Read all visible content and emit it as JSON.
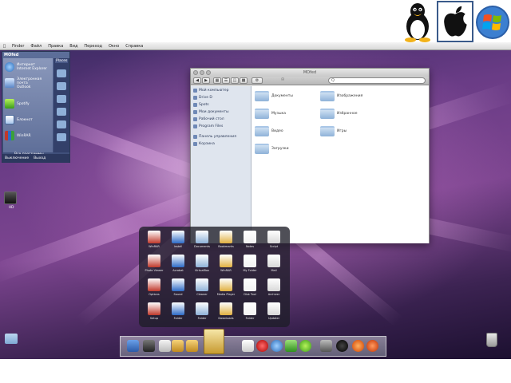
{
  "os_choices": [
    {
      "name": "linux-logo",
      "selected": false
    },
    {
      "name": "apple-logo",
      "selected": true
    },
    {
      "name": "windows-logo",
      "selected": false
    }
  ],
  "menubar": {
    "items": [
      "Finder",
      "Файл",
      "Правка",
      "Вид",
      "Переход",
      "Окно",
      "Справка"
    ]
  },
  "start_menu": {
    "user": "MOfed",
    "places_label": "Places",
    "items": [
      {
        "label": "Интернет",
        "sub": "Internet Explorer",
        "icon": "ie-icon"
      },
      {
        "label": "Электронная почта",
        "sub": "Outlook",
        "icon": "mail-icon"
      },
      {
        "label": "Spotify",
        "sub": "",
        "icon": "green-app-icon"
      },
      {
        "label": "Блокнот",
        "sub": "",
        "icon": "notepad-icon"
      },
      {
        "label": "WinRAR",
        "sub": "",
        "icon": "winrar-icon"
      }
    ],
    "all_programs": "Все программы",
    "bottom": [
      "Выключение",
      "Выход"
    ]
  },
  "desktop": {
    "hd_label": "HD"
  },
  "finder": {
    "title": "MOfed",
    "search_placeholder": "Q",
    "sidebar": [
      "Мой компьютер",
      "Drive D",
      "Spots",
      "Мои документы",
      "Рабочий стол",
      "Program Files",
      "Панель управления",
      "Корзина"
    ],
    "folders_left": [
      "Документы",
      "Музыка",
      "Видео",
      "Загрузки"
    ],
    "folders_right": [
      "Изображения",
      "Избранное",
      "Игры"
    ]
  },
  "stack": {
    "rows": [
      [
        "WinRAR",
        "Install",
        "Documents",
        "Bookmarks",
        "Notes",
        "Script"
      ],
      [
        "Photo Viewer",
        "Acrobat",
        "VirtualBox",
        "WinRAR",
        "My Folder",
        "Mail"
      ],
      [
        "Options",
        "Sound",
        "Cleaner",
        "Media Player",
        "Disk Tool",
        "Archiver"
      ],
      [
        "Setup",
        "Folder",
        "Folder",
        "Downloads",
        "Folder",
        "Updater"
      ]
    ]
  },
  "colors": {
    "finder_sidebar": "#dfe5ee",
    "folder_blue": "#8eb2d8",
    "desktop_purple": "#6a3c86"
  }
}
